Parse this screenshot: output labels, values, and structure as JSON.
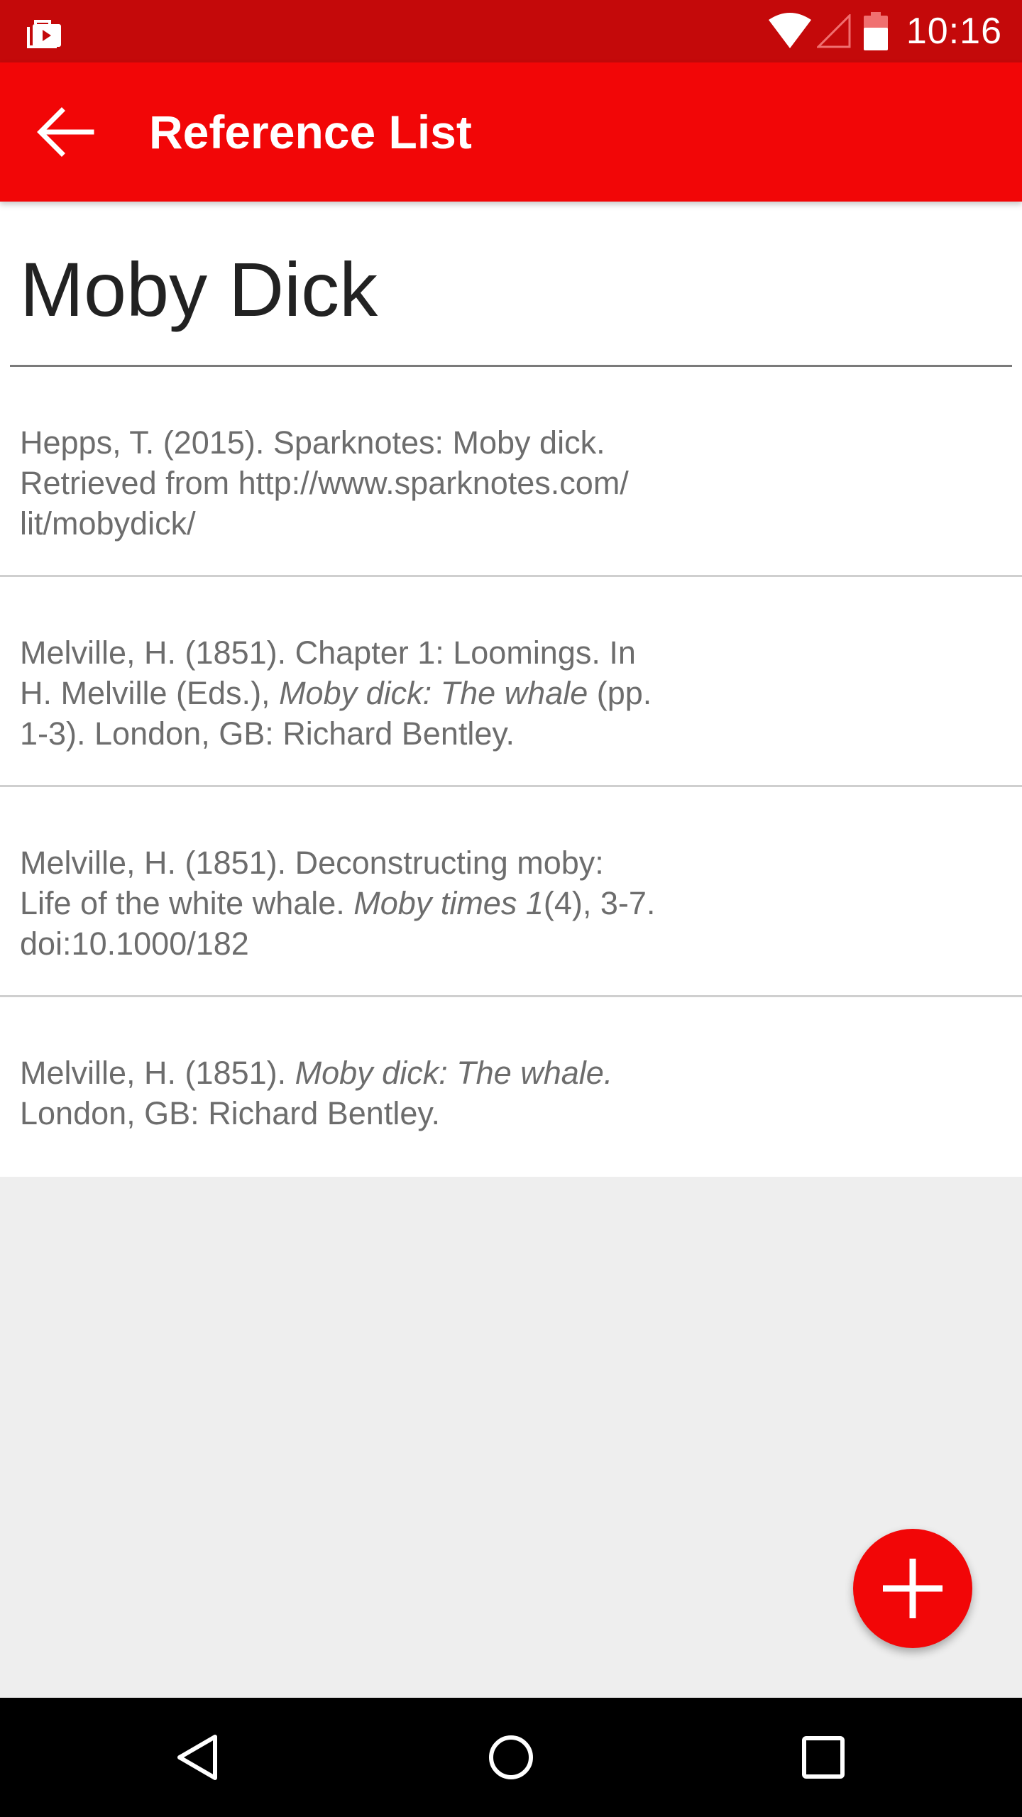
{
  "status_bar": {
    "time": "10:16",
    "left_icon": "briefcase-play-icon",
    "right_icons": [
      "wifi-icon",
      "cell-signal-icon",
      "battery-icon"
    ],
    "color": "#c4090a"
  },
  "app_bar": {
    "title": "Reference List",
    "back_icon": "arrow-left-icon",
    "color": "#f20607"
  },
  "document": {
    "title": "Moby Dick"
  },
  "references": [
    {
      "lines": [
        {
          "segments": [
            {
              "text": "Hepps,  T. (2015). Sparknotes: Moby dick.",
              "italic": false
            }
          ]
        },
        {
          "segments": [
            {
              "text": "Retrieved from http://www.sparknotes.com/",
              "italic": false
            }
          ]
        },
        {
          "segments": [
            {
              "text": "lit/mobydick/",
              "italic": false
            }
          ]
        }
      ]
    },
    {
      "lines": [
        {
          "segments": [
            {
              "text": "Melville,  H. (1851). Chapter 1: Loomings. In",
              "italic": false
            }
          ]
        },
        {
          "segments": [
            {
              "text": "H. Melville (Eds.), ",
              "italic": false
            },
            {
              "text": "Moby dick: The whale",
              "italic": true
            },
            {
              "text": " (pp.",
              "italic": false
            }
          ]
        },
        {
          "segments": [
            {
              "text": "1-3). London, GB: Richard Bentley.",
              "italic": false
            }
          ]
        }
      ]
    },
    {
      "lines": [
        {
          "segments": [
            {
              "text": "Melville,  H. (1851). Deconstructing moby:",
              "italic": false
            }
          ]
        },
        {
          "segments": [
            {
              "text": "Life of the white whale. ",
              "italic": false
            },
            {
              "text": "Moby times 1",
              "italic": true
            },
            {
              "text": "(4), 3-7.",
              "italic": false
            }
          ]
        },
        {
          "segments": [
            {
              "text": "doi:10.1000/182",
              "italic": false
            }
          ]
        }
      ]
    },
    {
      "lines": [
        {
          "segments": [
            {
              "text": "Melville,  H. (1851). ",
              "italic": false
            },
            {
              "text": "Moby dick: The whale.",
              "italic": true
            }
          ]
        },
        {
          "segments": [
            {
              "text": "London, GB: Richard Bentley.",
              "italic": false
            }
          ]
        }
      ]
    }
  ],
  "fab": {
    "icon": "plus-icon",
    "color": "#f20607"
  },
  "nav_bar": {
    "icons": [
      "nav-back-icon",
      "nav-home-icon",
      "nav-recent-icon"
    ]
  }
}
